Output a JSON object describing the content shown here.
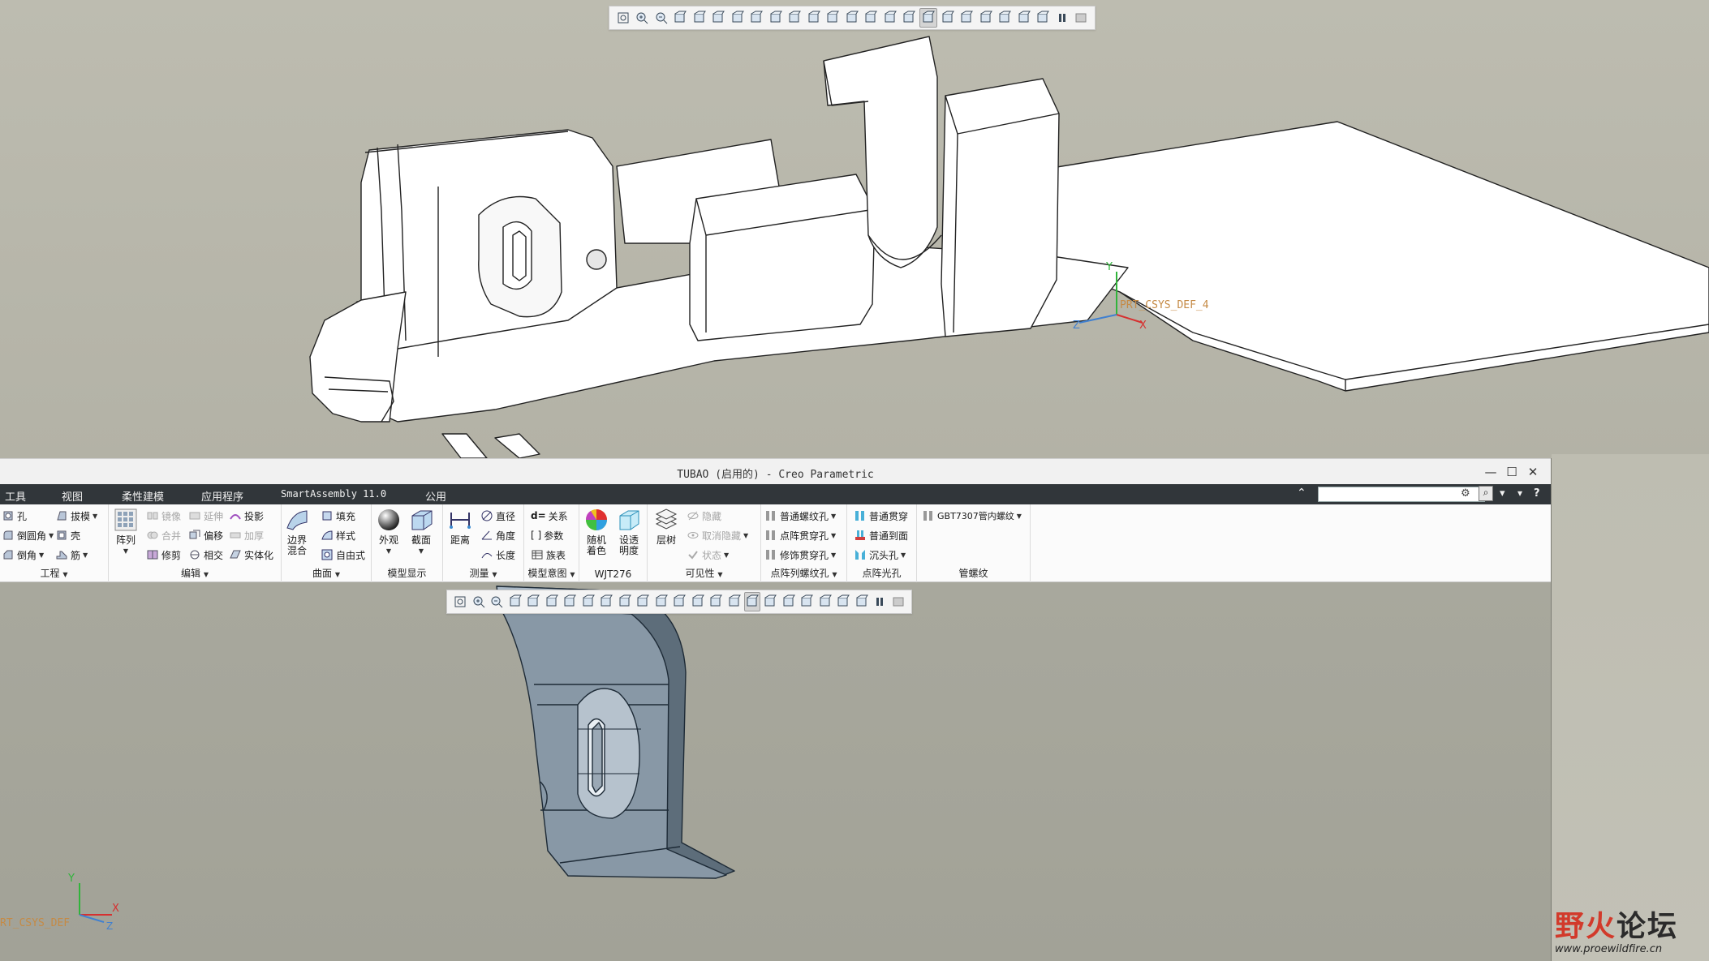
{
  "viewport_top": {
    "csys_label": "PRT_CSYS_DEF_4",
    "axis_x": "X",
    "axis_y": "Y",
    "axis_z": "Z",
    "toolbar_icons": [
      "refit-icon",
      "zoom-in-icon",
      "zoom-out-icon",
      "repaint-icon",
      "display-style-icon",
      "saved-orientations-icon",
      "view-manager-icon",
      "perspective-icon",
      "annotation-display-icon",
      "datum-plane-display-icon",
      "datum-axis-display-icon",
      "point-display-icon",
      "csys-display-icon",
      "spin-center-icon",
      "annotation-icon",
      "plane-tag-icon",
      "axis-tag-icon",
      "point-tag-icon",
      "csys-tag-icon",
      "rotate-center-icon",
      "bookmark-icon",
      "model-tree-icon",
      "filter-icon",
      "pause-icon",
      "exit-icon"
    ],
    "toolbar_active_index": 16
  },
  "window": {
    "title": "TUBAO (启用的) - Creo Parametric",
    "controls": {
      "minimize": "—",
      "maximize": "☐",
      "close": "✕"
    }
  },
  "menu": {
    "items": [
      "工具",
      "视图",
      "柔性建模",
      "应用程序",
      "SmartAssembly 11.0",
      "公用"
    ],
    "search_placeholder": ""
  },
  "ribbon": {
    "groups": {
      "engineering": {
        "label": "工程",
        "hole": "孔",
        "draft": "拔模",
        "round": "倒圆角",
        "shell": "壳",
        "chamfer": "倒角",
        "rib": "筋"
      },
      "editing": {
        "label": "编辑",
        "pattern": "阵列",
        "mirror": "镜像",
        "extend": "延伸",
        "project": "投影",
        "merge": "合并",
        "offset": "偏移",
        "thicken": "加厚",
        "trim": "修剪",
        "intersect": "相交",
        "solidify": "实体化"
      },
      "surface": {
        "label": "曲面",
        "boundary_blend_1": "边界",
        "boundary_blend_2": "混合",
        "fill": "填充",
        "style": "样式",
        "freestyle": "自由式"
      },
      "model_display": {
        "label": "模型显示",
        "appearance": "外观",
        "section": "截面"
      },
      "measure": {
        "label": "测量",
        "distance": "距离",
        "diameter": "直径",
        "angle": "角度",
        "length": "长度"
      },
      "model_intent": {
        "label": "模型意图",
        "relations": "关系",
        "parameters": "参数",
        "family_table": "族表"
      },
      "wjt": {
        "label": "WJT276",
        "random_color_1": "随机",
        "random_color_2": "着色",
        "transparency_1": "设透",
        "transparency_2": "明度"
      },
      "visibility": {
        "label": "可见性",
        "layers": "层树",
        "hide": "隐藏",
        "unhide": "取消隐藏",
        "status": "状态"
      },
      "pattern_thread_hole": {
        "label": "点阵列螺纹孔",
        "normal_thread": "普通螺纹孔",
        "point_through": "点阵贯穿孔",
        "cosmetic_through": "修饰贯穿孔"
      },
      "pattern_plain_hole": {
        "label": "点阵光孔",
        "normal_through": "普通贯穿",
        "normal_to_surface": "普通到面",
        "countersink": "沉头孔"
      },
      "pipe_thread": {
        "label": "管螺纹",
        "gbt": "GBT7307管内螺纹"
      }
    }
  },
  "viewport_bottom": {
    "csys_label": "RT_CSYS_DEF",
    "axis_x": "X",
    "axis_y": "Y",
    "axis_z": "Z",
    "toolbar_active_index": 16
  },
  "watermark": {
    "brand_red": "野火",
    "brand_dark": "论坛",
    "url": "www.proewildfire.cn"
  },
  "colors": {
    "menubar": "#31363a",
    "viewport": "#a7a79c",
    "part_fill": "#8898a6",
    "csys_label": "#c58a45"
  }
}
